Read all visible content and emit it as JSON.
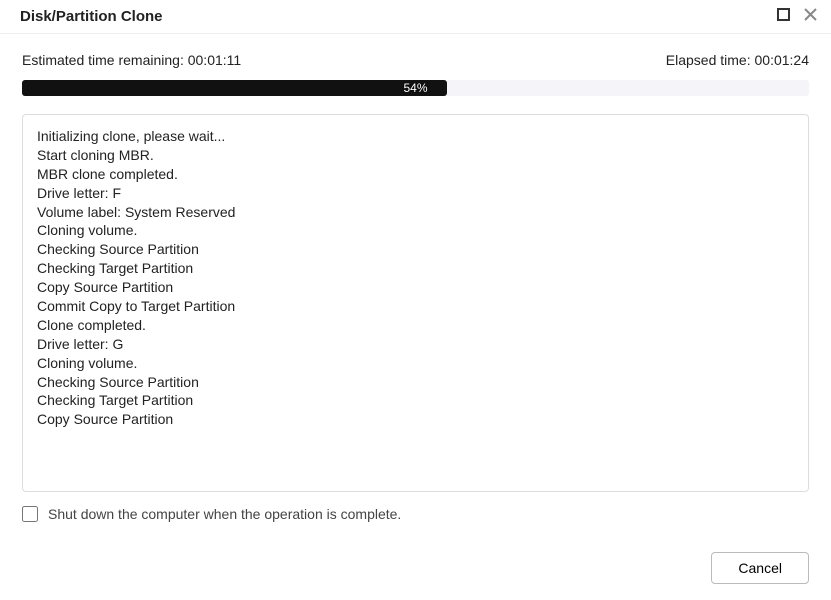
{
  "window": {
    "title": "Disk/Partition Clone"
  },
  "times": {
    "remaining_label": "Estimated time remaining:",
    "remaining_value": "00:01:11",
    "elapsed_label": "Elapsed time:",
    "elapsed_value": "00:01:24"
  },
  "progress": {
    "percent": 54,
    "label": "54%"
  },
  "log": [
    "Initializing clone, please wait...",
    "Start cloning MBR.",
    "MBR clone completed.",
    "Drive letter: F",
    "Volume label: System Reserved",
    "Cloning volume.",
    "Checking Source Partition",
    "Checking Target Partition",
    "Copy Source Partition",
    "Commit Copy to Target Partition",
    "Clone completed.",
    "Drive letter: G",
    "Cloning volume.",
    "Checking Source Partition",
    "Checking Target Partition",
    "Copy Source Partition"
  ],
  "shutdown": {
    "checked": false,
    "label": "Shut down the computer when the operation is complete."
  },
  "buttons": {
    "cancel": "Cancel"
  }
}
